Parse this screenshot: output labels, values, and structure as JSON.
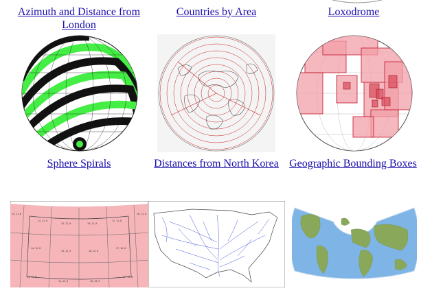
{
  "gallery": {
    "row1": {
      "azimuth_label_line1": "Azimuth and Distance from",
      "azimuth_label_line2": "London",
      "countries_label": "Countries by Area",
      "loxodrome_label": "Loxodrome"
    },
    "row2": {
      "sphere_spirals_label": "Sphere Spirals",
      "distances_label": "Distances from North Korea",
      "bounding_boxes_label": "Geographic Bounding Boxes"
    },
    "row3": {
      "grid_cells": [
        "14, 11, 8",
        "14, 11, 9",
        "16, 11, 9",
        "17, 11, 8",
        "16, 11, 8",
        "14, 12, 8",
        "14, 12, 9",
        "16, 12, 8",
        "17, 12, 8",
        "14, 13, 8",
        "15, 13, 9",
        "16, 13, 9",
        "17, 13, 8"
      ]
    }
  },
  "colors": {
    "link": "#1a0dab",
    "spiral_green": "#44ee44",
    "bbox_fill": "#f2a0a8",
    "bbox_stroke": "#c0142a",
    "distance_ring": "#c71e1e",
    "river_blue": "#2b44d0",
    "ocean": "#7fb5e6",
    "land": "#8aa85a"
  },
  "icons": [
    "sphere-spirals-globe",
    "azimuthal-distance-map",
    "bounding-box-globe",
    "tile-grid-map",
    "us-rivers-map",
    "conic-world-map"
  ]
}
